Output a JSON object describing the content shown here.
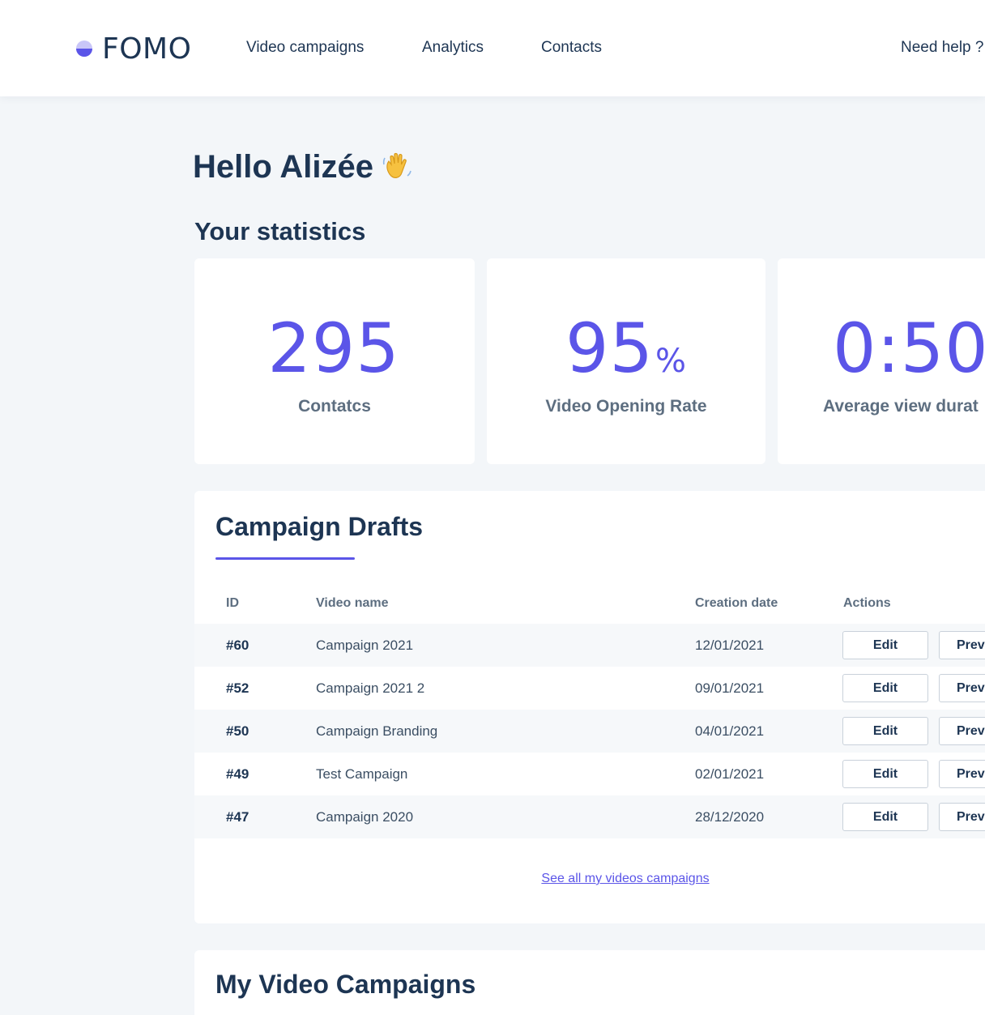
{
  "brand": {
    "name": "FOMO",
    "accent": "#5b55e8",
    "text_color": "#1d3553"
  },
  "nav": {
    "items": [
      {
        "label": "Video campaigns"
      },
      {
        "label": "Analytics"
      },
      {
        "label": "Contacts"
      }
    ],
    "help_label": "Need help ?"
  },
  "greeting": {
    "text": "Hello Alizée",
    "icon": "waving-hand-icon"
  },
  "stats": {
    "title": "Your statistics",
    "cards": [
      {
        "value": "295",
        "unit": "",
        "label": "Contatcs"
      },
      {
        "value": "95",
        "unit": "%",
        "label": "Video Opening Rate"
      },
      {
        "value": "0:50",
        "unit": "",
        "label": "Average view durat"
      }
    ]
  },
  "drafts": {
    "title": "Campaign Drafts",
    "columns": {
      "id": "ID",
      "name": "Video name",
      "date": "Creation date",
      "actions": "Actions"
    },
    "rows": [
      {
        "id": "#60",
        "name": "Campaign 2021",
        "date": "12/01/2021"
      },
      {
        "id": "#52",
        "name": "Campaign 2021 2",
        "date": "09/01/2021"
      },
      {
        "id": "#50",
        "name": "Campaign Branding",
        "date": "04/01/2021"
      },
      {
        "id": "#49",
        "name": "Test Campaign",
        "date": "02/01/2021"
      },
      {
        "id": "#47",
        "name": "Campaign 2020",
        "date": "28/12/2020"
      }
    ],
    "edit_label": "Edit",
    "preview_label": "Prev",
    "see_all_label": "See all my videos campaigns"
  },
  "campaigns": {
    "title": "My Video Campaigns"
  }
}
